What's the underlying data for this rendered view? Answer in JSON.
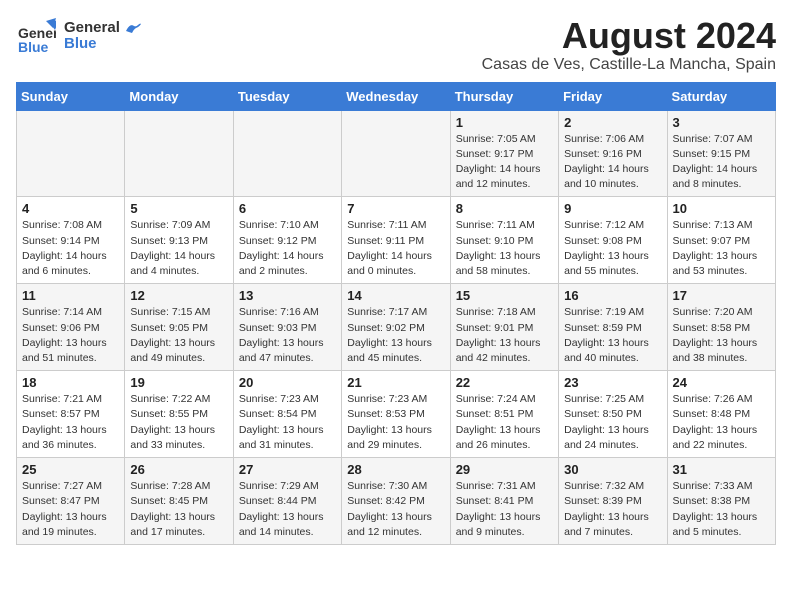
{
  "logo": {
    "general": "General",
    "blue": "Blue"
  },
  "title": "August 2024",
  "subtitle": "Casas de Ves, Castille-La Mancha, Spain",
  "headers": [
    "Sunday",
    "Monday",
    "Tuesday",
    "Wednesday",
    "Thursday",
    "Friday",
    "Saturday"
  ],
  "weeks": [
    [
      {
        "day": "",
        "info": ""
      },
      {
        "day": "",
        "info": ""
      },
      {
        "day": "",
        "info": ""
      },
      {
        "day": "",
        "info": ""
      },
      {
        "day": "1",
        "info": "Sunrise: 7:05 AM\nSunset: 9:17 PM\nDaylight: 14 hours\nand 12 minutes."
      },
      {
        "day": "2",
        "info": "Sunrise: 7:06 AM\nSunset: 9:16 PM\nDaylight: 14 hours\nand 10 minutes."
      },
      {
        "day": "3",
        "info": "Sunrise: 7:07 AM\nSunset: 9:15 PM\nDaylight: 14 hours\nand 8 minutes."
      }
    ],
    [
      {
        "day": "4",
        "info": "Sunrise: 7:08 AM\nSunset: 9:14 PM\nDaylight: 14 hours\nand 6 minutes."
      },
      {
        "day": "5",
        "info": "Sunrise: 7:09 AM\nSunset: 9:13 PM\nDaylight: 14 hours\nand 4 minutes."
      },
      {
        "day": "6",
        "info": "Sunrise: 7:10 AM\nSunset: 9:12 PM\nDaylight: 14 hours\nand 2 minutes."
      },
      {
        "day": "7",
        "info": "Sunrise: 7:11 AM\nSunset: 9:11 PM\nDaylight: 14 hours\nand 0 minutes."
      },
      {
        "day": "8",
        "info": "Sunrise: 7:11 AM\nSunset: 9:10 PM\nDaylight: 13 hours\nand 58 minutes."
      },
      {
        "day": "9",
        "info": "Sunrise: 7:12 AM\nSunset: 9:08 PM\nDaylight: 13 hours\nand 55 minutes."
      },
      {
        "day": "10",
        "info": "Sunrise: 7:13 AM\nSunset: 9:07 PM\nDaylight: 13 hours\nand 53 minutes."
      }
    ],
    [
      {
        "day": "11",
        "info": "Sunrise: 7:14 AM\nSunset: 9:06 PM\nDaylight: 13 hours\nand 51 minutes."
      },
      {
        "day": "12",
        "info": "Sunrise: 7:15 AM\nSunset: 9:05 PM\nDaylight: 13 hours\nand 49 minutes."
      },
      {
        "day": "13",
        "info": "Sunrise: 7:16 AM\nSunset: 9:03 PM\nDaylight: 13 hours\nand 47 minutes."
      },
      {
        "day": "14",
        "info": "Sunrise: 7:17 AM\nSunset: 9:02 PM\nDaylight: 13 hours\nand 45 minutes."
      },
      {
        "day": "15",
        "info": "Sunrise: 7:18 AM\nSunset: 9:01 PM\nDaylight: 13 hours\nand 42 minutes."
      },
      {
        "day": "16",
        "info": "Sunrise: 7:19 AM\nSunset: 8:59 PM\nDaylight: 13 hours\nand 40 minutes."
      },
      {
        "day": "17",
        "info": "Sunrise: 7:20 AM\nSunset: 8:58 PM\nDaylight: 13 hours\nand 38 minutes."
      }
    ],
    [
      {
        "day": "18",
        "info": "Sunrise: 7:21 AM\nSunset: 8:57 PM\nDaylight: 13 hours\nand 36 minutes."
      },
      {
        "day": "19",
        "info": "Sunrise: 7:22 AM\nSunset: 8:55 PM\nDaylight: 13 hours\nand 33 minutes."
      },
      {
        "day": "20",
        "info": "Sunrise: 7:23 AM\nSunset: 8:54 PM\nDaylight: 13 hours\nand 31 minutes."
      },
      {
        "day": "21",
        "info": "Sunrise: 7:23 AM\nSunset: 8:53 PM\nDaylight: 13 hours\nand 29 minutes."
      },
      {
        "day": "22",
        "info": "Sunrise: 7:24 AM\nSunset: 8:51 PM\nDaylight: 13 hours\nand 26 minutes."
      },
      {
        "day": "23",
        "info": "Sunrise: 7:25 AM\nSunset: 8:50 PM\nDaylight: 13 hours\nand 24 minutes."
      },
      {
        "day": "24",
        "info": "Sunrise: 7:26 AM\nSunset: 8:48 PM\nDaylight: 13 hours\nand 22 minutes."
      }
    ],
    [
      {
        "day": "25",
        "info": "Sunrise: 7:27 AM\nSunset: 8:47 PM\nDaylight: 13 hours\nand 19 minutes."
      },
      {
        "day": "26",
        "info": "Sunrise: 7:28 AM\nSunset: 8:45 PM\nDaylight: 13 hours\nand 17 minutes."
      },
      {
        "day": "27",
        "info": "Sunrise: 7:29 AM\nSunset: 8:44 PM\nDaylight: 13 hours\nand 14 minutes."
      },
      {
        "day": "28",
        "info": "Sunrise: 7:30 AM\nSunset: 8:42 PM\nDaylight: 13 hours\nand 12 minutes."
      },
      {
        "day": "29",
        "info": "Sunrise: 7:31 AM\nSunset: 8:41 PM\nDaylight: 13 hours\nand 9 minutes."
      },
      {
        "day": "30",
        "info": "Sunrise: 7:32 AM\nSunset: 8:39 PM\nDaylight: 13 hours\nand 7 minutes."
      },
      {
        "day": "31",
        "info": "Sunrise: 7:33 AM\nSunset: 8:38 PM\nDaylight: 13 hours\nand 5 minutes."
      }
    ]
  ]
}
